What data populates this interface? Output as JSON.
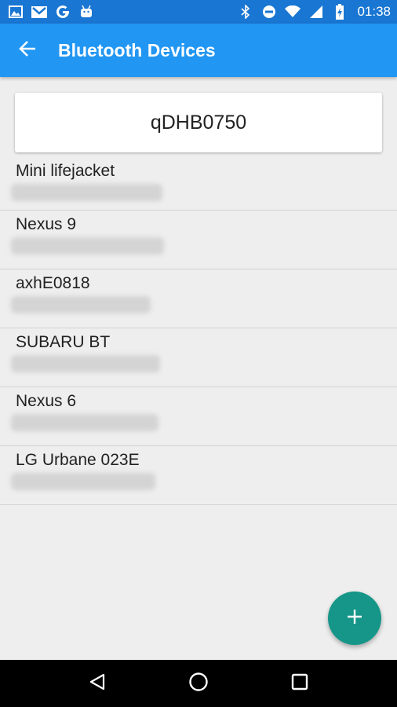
{
  "status_bar": {
    "time": "01:38",
    "left_icons": [
      "image-icon",
      "gmail-icon",
      "google-icon",
      "android-icon"
    ],
    "right_icons": [
      "bluetooth-icon",
      "do-not-disturb-icon",
      "wifi-icon",
      "cell-signal-icon",
      "battery-icon"
    ]
  },
  "app_bar": {
    "back_icon": "arrow-back-icon",
    "title": "Bluetooth Devices",
    "color": "#2196f3"
  },
  "search": {
    "value": "qDHB0750"
  },
  "devices": [
    {
      "name": "Mini lifejacket"
    },
    {
      "name": "Nexus 9"
    },
    {
      "name": "axhE0818"
    },
    {
      "name": "SUBARU BT"
    },
    {
      "name": "Nexus 6"
    },
    {
      "name": "LG Urbane 023E"
    }
  ],
  "fab": {
    "icon": "plus-icon",
    "color": "#159688"
  },
  "nav_bar": {
    "icons": [
      "back-triangle-icon",
      "home-circle-icon",
      "recents-square-icon"
    ]
  }
}
